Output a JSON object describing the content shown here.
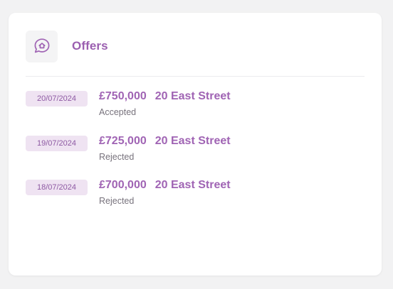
{
  "header": {
    "title": "Offers",
    "icon": "home-chat-icon"
  },
  "colors": {
    "accent": "#a064b4",
    "badge_bg": "#efe3f2",
    "status_text": "#77727c"
  },
  "offers": [
    {
      "date": "20/07/2024",
      "amount": "£750,000",
      "address": "20 East Street",
      "status": "Accepted"
    },
    {
      "date": "19/07/2024",
      "amount": "£725,000",
      "address": "20 East Street",
      "status": "Rejected"
    },
    {
      "date": "18/07/2024",
      "amount": "£700,000",
      "address": "20 East Street",
      "status": "Rejected"
    }
  ]
}
